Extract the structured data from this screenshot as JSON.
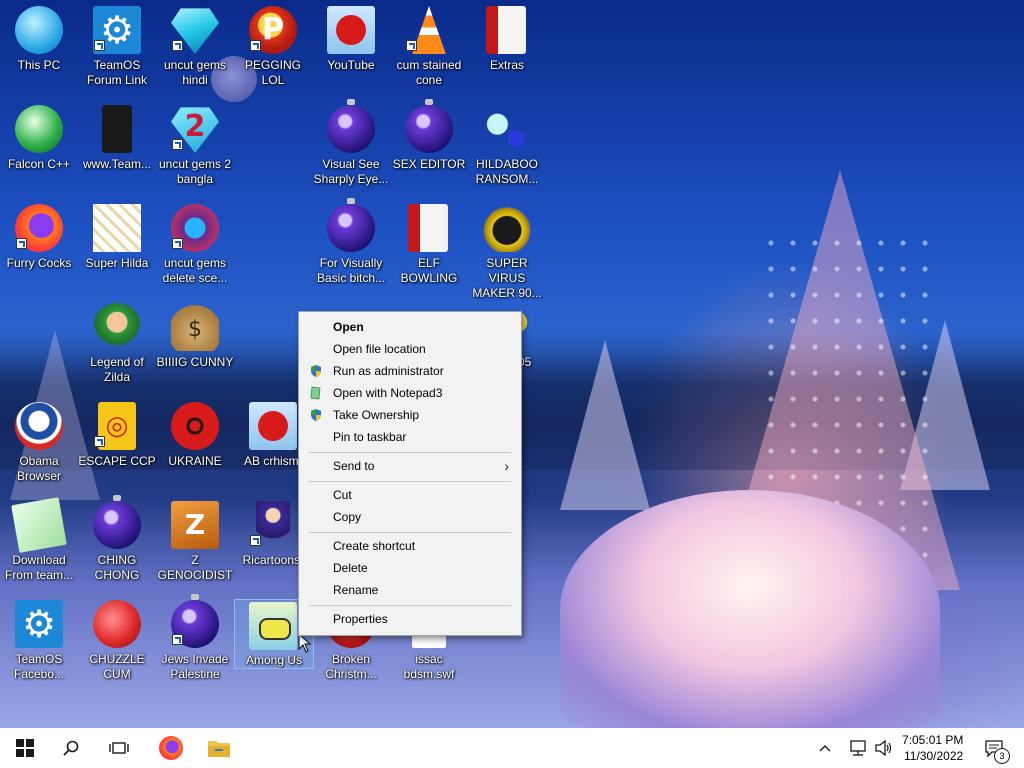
{
  "desktop": {
    "icons": [
      {
        "label": "This PC"
      },
      {
        "label": "TeamOS Forum Link"
      },
      {
        "label": "uncut gems hindi"
      },
      {
        "label": "PEGGING LOL"
      },
      {
        "label": "YouTube"
      },
      {
        "label": "cum stained cone"
      },
      {
        "label": "Extras"
      },
      {
        "label": "Falcon C++"
      },
      {
        "label": "www.Team..."
      },
      {
        "label": "uncut gems 2 bangla"
      },
      {
        "label": "Visual See Sharply Eye..."
      },
      {
        "label": "SEX EDITOR"
      },
      {
        "label": "HILDABOO RANSOM..."
      },
      {
        "label": "Furry Cocks"
      },
      {
        "label": "Super Hilda"
      },
      {
        "label": "uncut gems delete sce..."
      },
      {
        "label": "For Visually Basic bitch..."
      },
      {
        "label": "ELF BOWLING"
      },
      {
        "label": "SUPER VIRUS MAKER 90..."
      },
      {
        "label": "Legend of Zilda"
      },
      {
        "label": "BIIIIG CUNNY"
      },
      {
        "label": "RUS 005"
      },
      {
        "label": "Obama Browser"
      },
      {
        "label": "ESCAPE CCP"
      },
      {
        "label": "UKRAINE"
      },
      {
        "label": "AB crhismt"
      },
      {
        "label": "Download From team..."
      },
      {
        "label": "CHING CHONG"
      },
      {
        "label": "Z GENOCIDIST"
      },
      {
        "label": "Ricartoons."
      },
      {
        "label": "TeamOS Facebo..."
      },
      {
        "label": "CHUZZLE CUM"
      },
      {
        "label": "Jews Invade Palestine"
      },
      {
        "label": "Among Us"
      },
      {
        "label": "Broken Christm..."
      },
      {
        "label": "issac bdsm.swf"
      }
    ]
  },
  "context_menu": {
    "open": "Open",
    "open_file_location": "Open file location",
    "run_as_admin": "Run as administrator",
    "open_with_notepad3": "Open with Notepad3",
    "take_ownership": "Take Ownership",
    "pin_to_taskbar": "Pin to taskbar",
    "send_to": "Send to",
    "cut": "Cut",
    "copy": "Copy",
    "create_shortcut": "Create shortcut",
    "delete": "Delete",
    "rename": "Rename",
    "properties": "Properties"
  },
  "taskbar": {
    "time": "7:05:01 PM",
    "date": "11/30/2022",
    "notification_count": "3"
  },
  "colors": {
    "desktop_sky": "#1d4fc1",
    "menu_bg": "#f2f2f2",
    "taskbar_bg": "#ffffff",
    "start_blue": "#2a2a2a"
  }
}
